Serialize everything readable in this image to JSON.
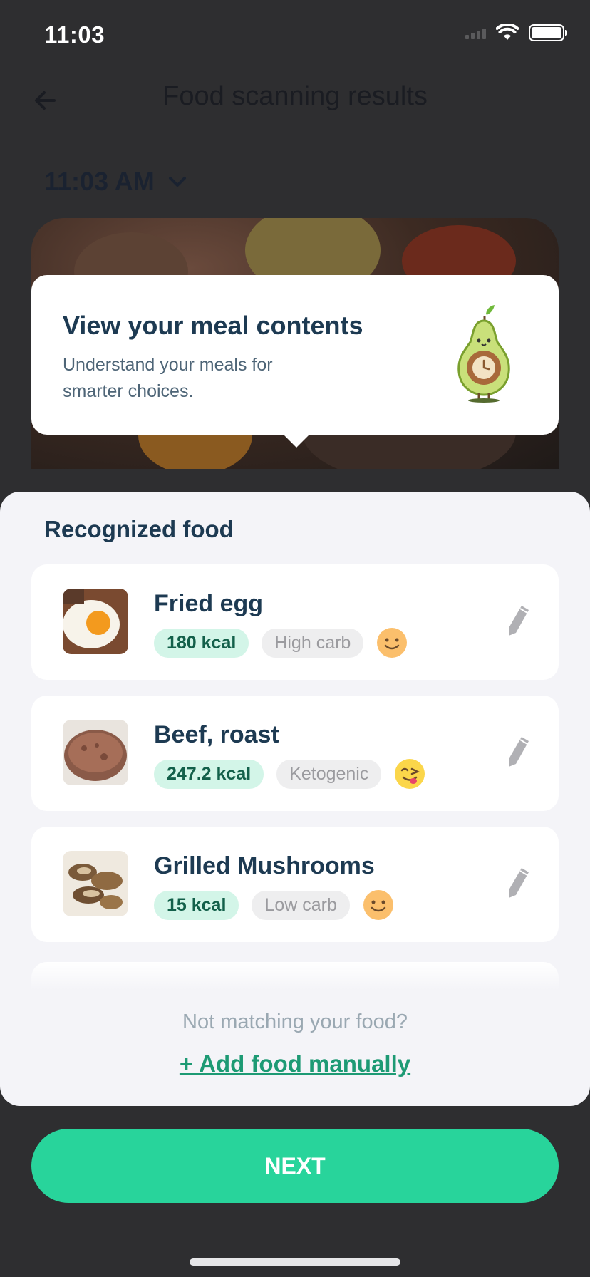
{
  "status": {
    "time": "11:03"
  },
  "header": {
    "title": "Food scanning results",
    "back_icon": "arrow-left-icon"
  },
  "time_select": {
    "value": "11:03 AM",
    "icon": "chevron-down-icon"
  },
  "tooltip": {
    "title": "View your meal contents",
    "text": "Understand your meals for smarter choices.",
    "illustration": "pear-clock-mascot"
  },
  "recognized": {
    "title": "Recognized food",
    "items": [
      {
        "name": "Fried egg",
        "kcal": "180 kcal",
        "diet": "High carb",
        "emoji": "smile-icon",
        "thumb": "fried-egg-photo"
      },
      {
        "name": "Beef, roast",
        "kcal": "247.2 kcal",
        "diet": "Ketogenic",
        "emoji": "yum-icon",
        "thumb": "roast-beef-photo"
      },
      {
        "name": "Grilled Mushrooms",
        "kcal": "15 kcal",
        "diet": "Low carb",
        "emoji": "smile-icon",
        "thumb": "mushrooms-photo"
      }
    ]
  },
  "footer": {
    "not_matching": "Not matching your food?",
    "add_manual": "+ Add food manually"
  },
  "next_label": "NEXT",
  "colors": {
    "accent": "#28d49b",
    "title": "#1d3a52",
    "kcal_bg": "#d3f5e8",
    "overlay": "#2e2e30"
  }
}
